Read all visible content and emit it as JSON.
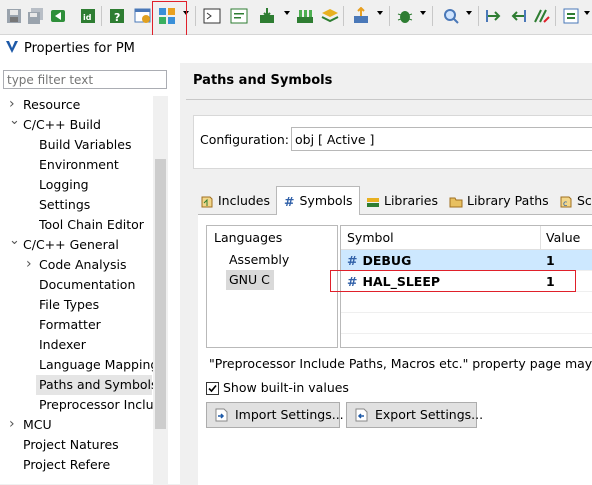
{
  "window": {
    "title": "Properties for PM"
  },
  "toolbar": {
    "icons": [
      "save-icon",
      "save-all-icon",
      "restore-icon",
      "id-icon",
      "help-icon",
      "window-config-icon",
      "perspective-icon",
      "terminal-icon",
      "console-icon",
      "build-icon",
      "build-all-icon",
      "layers-icon",
      "export-icon",
      "debug-icon",
      "search-icon",
      "step-into-icon",
      "step-over-icon",
      "resume-icon",
      "settings-icon"
    ]
  },
  "filter": {
    "placeholder": "type filter text"
  },
  "tree": {
    "items": [
      {
        "label": "Resource",
        "twisty": ">"
      },
      {
        "label": "C/C++ Build",
        "twisty": "v"
      },
      {
        "label": "Build Variables",
        "twisty": ""
      },
      {
        "label": "Environment",
        "twisty": ""
      },
      {
        "label": "Logging",
        "twisty": ""
      },
      {
        "label": "Settings",
        "twisty": ""
      },
      {
        "label": "Tool Chain Editor",
        "twisty": ""
      },
      {
        "label": "C/C++ General",
        "twisty": "v"
      },
      {
        "label": "Code Analysis",
        "twisty": ">"
      },
      {
        "label": "Documentation",
        "twisty": ""
      },
      {
        "label": "File Types",
        "twisty": ""
      },
      {
        "label": "Formatter",
        "twisty": ""
      },
      {
        "label": "Indexer",
        "twisty": ""
      },
      {
        "label": "Language Mapping",
        "twisty": ""
      },
      {
        "label": "Paths and Symbols",
        "twisty": ""
      },
      {
        "label": "Preprocessor Incluc",
        "twisty": ""
      },
      {
        "label": "MCU",
        "twisty": ">"
      },
      {
        "label": "Project Natures",
        "twisty": ""
      },
      {
        "label": "Project Refere",
        "twisty": ""
      }
    ],
    "selected": "Paths and Symbols"
  },
  "page": {
    "title": "Paths and Symbols"
  },
  "configuration": {
    "label": "Configuration:",
    "value": "obj  [ Active ]"
  },
  "tabs": [
    {
      "label": "Includes"
    },
    {
      "label": "Symbols"
    },
    {
      "label": "Libraries"
    },
    {
      "label": "Library Paths"
    },
    {
      "label": "Sc"
    }
  ],
  "active_tab": "Symbols",
  "languages": {
    "header": "Languages",
    "items": [
      "Assembly",
      "GNU C"
    ],
    "selected": "GNU C"
  },
  "symbols": {
    "columns": [
      "Symbol",
      "Value"
    ],
    "rows": [
      {
        "symbol": "DEBUG",
        "value": "1"
      },
      {
        "symbol": "HAL_SLEEP",
        "value": "1"
      }
    ]
  },
  "info_text": "\"Preprocessor Include Paths, Macros etc.\" property page may def",
  "show_builtin": {
    "label": "Show built-in values",
    "checked": true
  },
  "buttons": {
    "import": "Import Settings...",
    "export": "Export Settings..."
  },
  "colors": {
    "highlight": "#e0202a",
    "selection": "#cde8ff",
    "hash": "#3060a8"
  }
}
